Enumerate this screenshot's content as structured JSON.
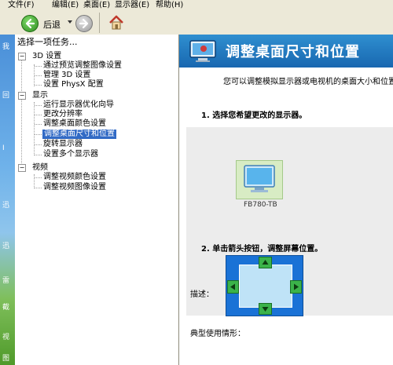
{
  "menubar": {
    "items": [
      "文件(F)",
      "编辑(E)",
      "桌面(E)",
      "显示器(E)",
      "帮助(H)"
    ]
  },
  "toolbar": {
    "back_label": "后退",
    "back_icon": "back-arrow-icon",
    "forward_icon": "forward-arrow-icon",
    "home_icon": "home-icon"
  },
  "desktop_strip": {
    "chars": [
      "我",
      "回",
      "I",
      "迅",
      "迅",
      "雷",
      "截",
      "视",
      "图"
    ]
  },
  "tree": {
    "title": "选择一项任务...",
    "categories": [
      {
        "label": "3D 设置",
        "expander": "−",
        "items": [
          "通过预览调整图像设置",
          "管理 3D 设置",
          "设置 PhysX 配置"
        ]
      },
      {
        "label": "显示",
        "expander": "−",
        "items": [
          "运行显示器优化向导",
          "更改分辨率",
          "调整桌面颜色设置",
          "调整桌面尺寸和位置",
          "旋转显示器",
          "设置多个显示器"
        ]
      },
      {
        "label": "视频",
        "expander": "−",
        "items": [
          "调整视频颜色设置",
          "调整视频图像设置"
        ]
      }
    ],
    "selected_item": "调整桌面尺寸和位置"
  },
  "main": {
    "title": "调整桌面尺寸和位置",
    "description": "您可以调整模拟显示器或电视机的桌面大小和位置",
    "step1": "1. 选择您希望更改的显示器。",
    "monitor_name": "FB780-TB",
    "step2": "2. 单击箭头按钮，调整屏幕位置。",
    "describe_label": "描述：",
    "usage_label": "典型使用情形："
  },
  "colors": {
    "header_blue": "#1e78c2",
    "selection": "#316ac5",
    "arrow_green": "#3bb34a"
  }
}
